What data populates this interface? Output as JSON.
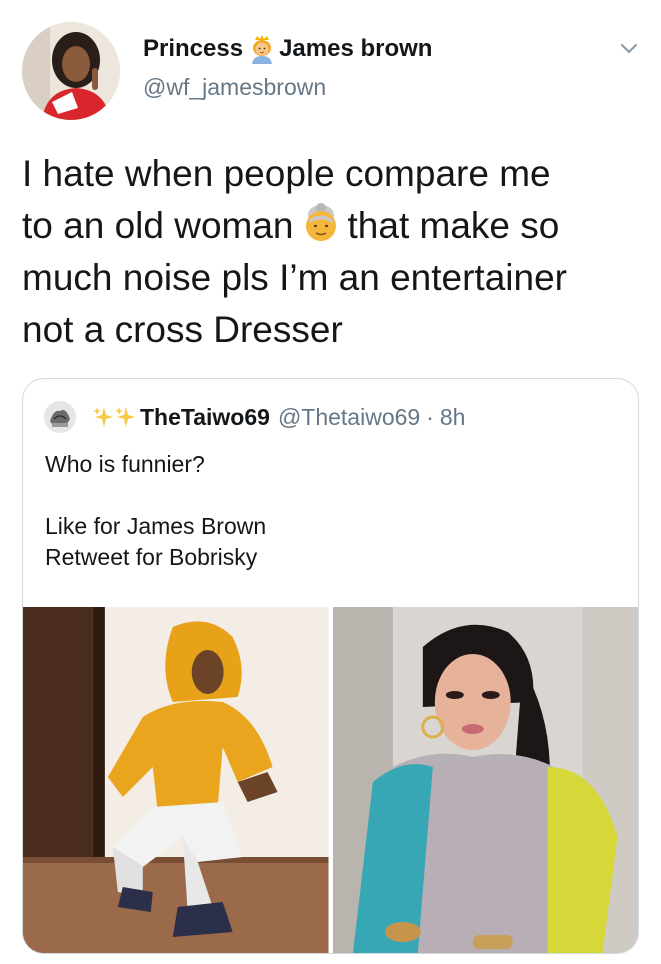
{
  "tweet": {
    "author": {
      "name_part1": "Princess",
      "name_emoji": "princess-emoji",
      "name_part2": "James brown",
      "handle": "@wf_jamesbrown"
    },
    "text": {
      "line1": "I hate when people compare me",
      "line2_a": "to an old woman",
      "line2_emoji": "old-woman-emoji",
      "line2_b": "that make so",
      "line3": "much noise pls I’m an entertainer",
      "line4": "not a cross Dresser"
    }
  },
  "quoted_tweet": {
    "author_name": "TheTaiwo69",
    "author_handle": "@Thetaiwo69",
    "separator": "·",
    "time": "8h",
    "name_decoration": "sparkles-emoji",
    "text": {
      "line1": "Who is funnier?",
      "line2": "Like for James Brown",
      "line3": "Retweet for Bobrisky"
    },
    "media": [
      {
        "description_icon": "photo-person-yellow-hoodie"
      },
      {
        "description_icon": "photo-person-long-hair"
      }
    ]
  },
  "colors": {
    "text_primary": "#14171a",
    "text_secondary": "#657786",
    "border": "#cfd9de"
  }
}
